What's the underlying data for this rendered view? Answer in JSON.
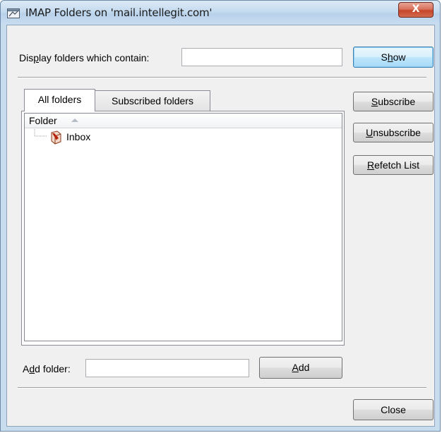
{
  "window": {
    "title": "IMAP Folders on 'mail.intellegit.com'",
    "close_glyph": "X"
  },
  "filter": {
    "label_pre": "Dis",
    "label_accel": "p",
    "label_post": "lay folders which contain:",
    "value": "",
    "show_pre": "S",
    "show_accel": "h",
    "show_post": "ow"
  },
  "tabs": [
    {
      "label": "All folders",
      "active": true
    },
    {
      "label": "Subscribed folders",
      "active": false
    }
  ],
  "folder_list": {
    "column_header": "Folder",
    "sort": "ascending",
    "items": [
      {
        "name": "Inbox",
        "icon": "inbox-icon"
      }
    ]
  },
  "side_buttons": {
    "subscribe_accel": "S",
    "subscribe_rest": "ubscribe",
    "unsubscribe_accel": "U",
    "unsubscribe_rest": "nsubscribe",
    "refetch_accel": "R",
    "refetch_rest": "efetch List"
  },
  "add_folder": {
    "label_pre": "A",
    "label_accel": "d",
    "label_post": "d folder:",
    "value": "",
    "button_accel": "A",
    "button_rest": "dd"
  },
  "footer": {
    "close_label": "Close"
  },
  "colors": {
    "titlebar": "#c5dbef",
    "close_button": "#c6452a",
    "default_button_border": "#3c7fb1",
    "dialog_face": "#f0f0f0"
  }
}
